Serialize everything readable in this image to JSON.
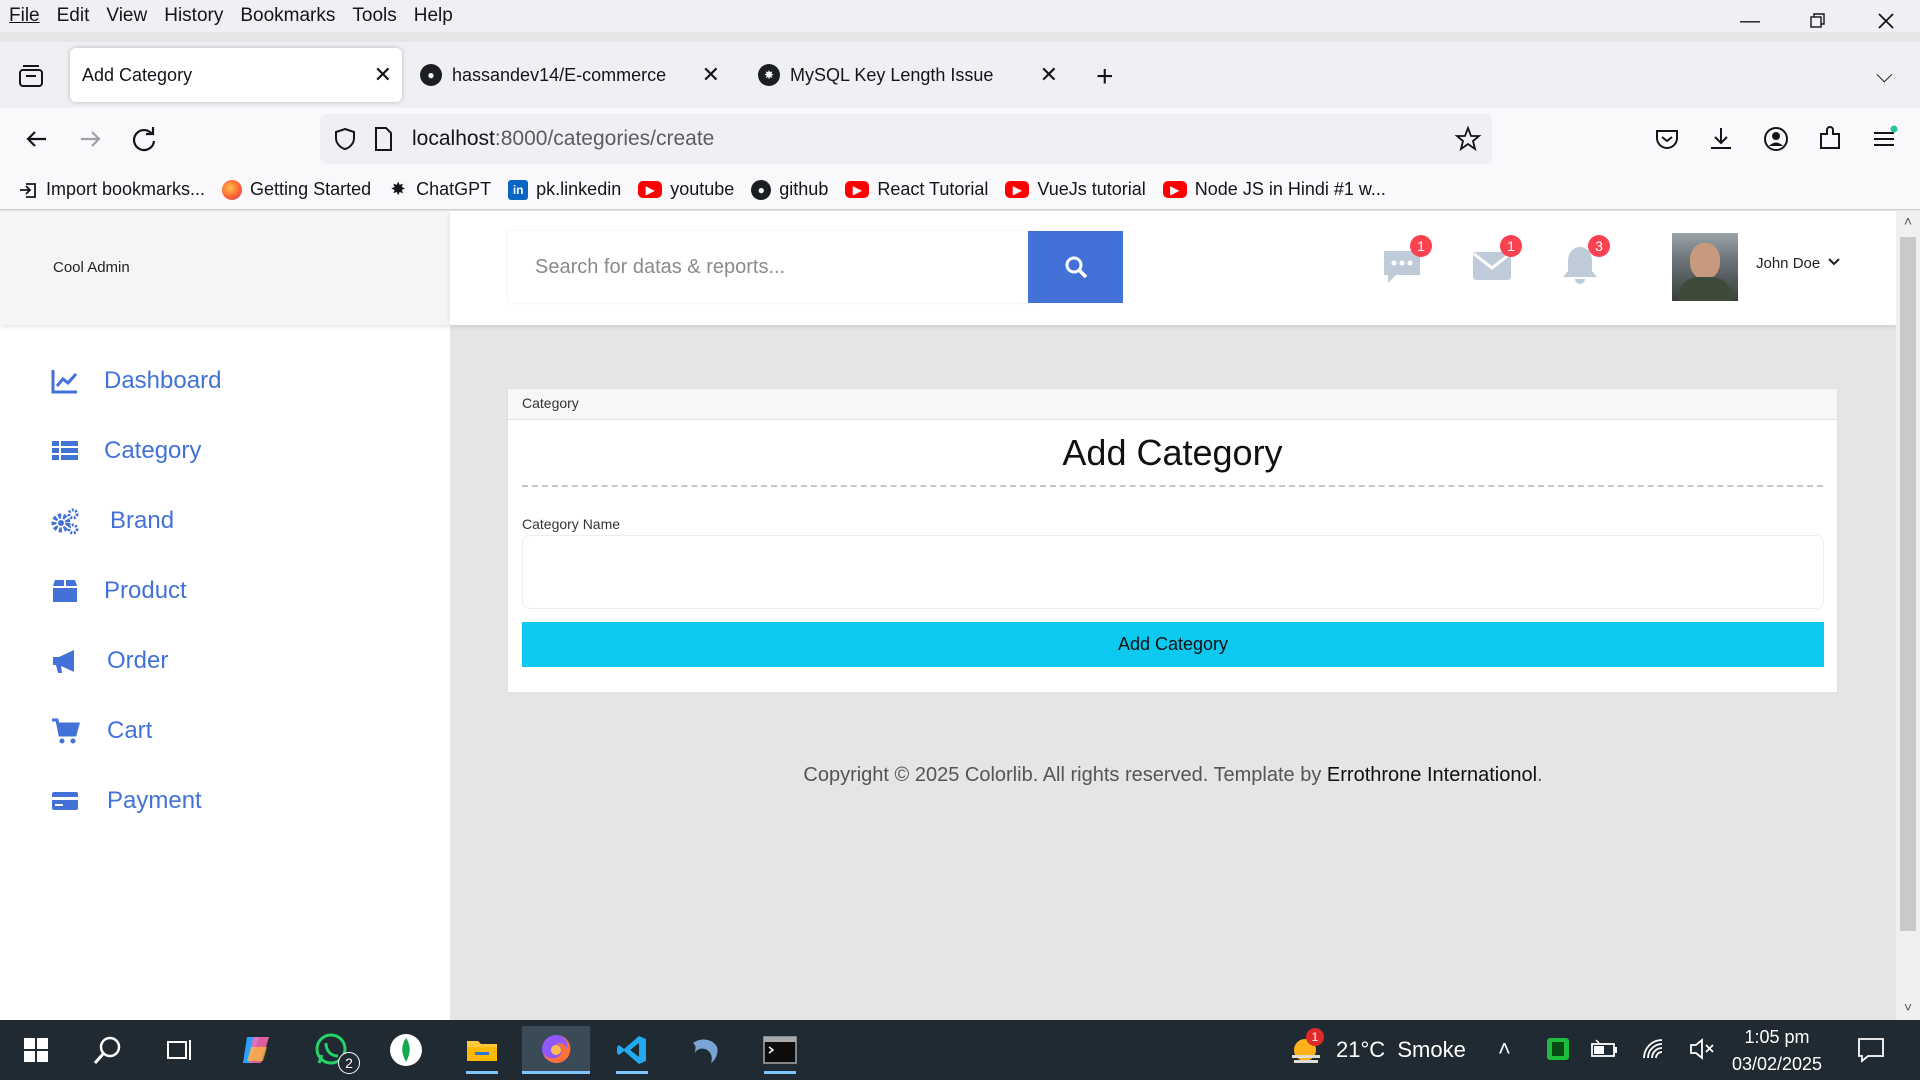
{
  "menu": [
    "File",
    "Edit",
    "View",
    "History",
    "Bookmarks",
    "Tools",
    "Help"
  ],
  "tabs": [
    {
      "title": "Add Category"
    },
    {
      "title": "hassandev14/E-commerce"
    },
    {
      "title": "MySQL Key Length Issue"
    }
  ],
  "url": {
    "host": "localhost",
    "path": ":8000/categories/create"
  },
  "bookmarks": [
    {
      "label": "Import bookmarks...",
      "icon": "import-icon"
    },
    {
      "label": "Getting Started",
      "icon": "firefox-icon"
    },
    {
      "label": "ChatGPT",
      "icon": "chatgpt-icon"
    },
    {
      "label": "pk.linkedin",
      "icon": "linkedin-icon"
    },
    {
      "label": "youtube",
      "icon": "youtube-icon"
    },
    {
      "label": "github",
      "icon": "github-icon"
    },
    {
      "label": "React Tutorial",
      "icon": "youtube-icon"
    },
    {
      "label": "VueJs tutorial",
      "icon": "youtube-icon"
    },
    {
      "label": "Node JS in Hindi #1 w...",
      "icon": "youtube-icon"
    }
  ],
  "app": {
    "logo": "Cool Admin",
    "search_placeholder": "Search for datas & reports...",
    "badges": {
      "chat": "1",
      "mail": "1",
      "notifications": "3"
    },
    "user_name": "John Doe"
  },
  "sidebar": {
    "items": [
      {
        "label": "Dashboard",
        "icon": "chart-line-icon"
      },
      {
        "label": "Category",
        "icon": "table-icon"
      },
      {
        "label": "Brand",
        "icon": "cogs-icon"
      },
      {
        "label": "Product",
        "icon": "box-icon"
      },
      {
        "label": "Order",
        "icon": "bullhorn-icon"
      },
      {
        "label": "Cart",
        "icon": "cart-icon"
      },
      {
        "label": "Payment",
        "icon": "credit-card-icon"
      }
    ]
  },
  "card": {
    "header": "Category",
    "title": "Add Category",
    "field_label": "Category Name",
    "field_value": "",
    "submit_label": "Add Category"
  },
  "footer": {
    "text": "Copyright © 2025 Colorlib. All rights reserved. Template by ",
    "link": "Errothrone Internationol",
    "end": "."
  },
  "taskbar": {
    "weather": "21°C  Smoke",
    "weather_badge": "1",
    "whatsapp_badge": "2",
    "time": "1:05 pm",
    "date": "03/02/2025"
  },
  "colors": {
    "accent": "#4272d7",
    "submit": "#0dc9ef",
    "badge": "#fa4251"
  }
}
